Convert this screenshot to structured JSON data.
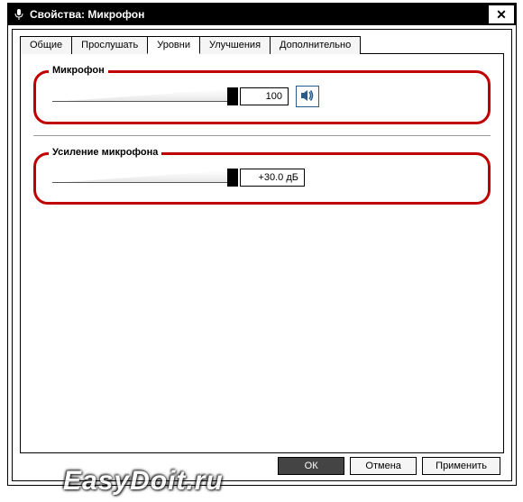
{
  "window": {
    "title": "Свойства: Микрофон",
    "close_label": "✕"
  },
  "tabs": [
    {
      "label": "Общие",
      "active": false
    },
    {
      "label": "Прослушать",
      "active": false
    },
    {
      "label": "Уровни",
      "active": true
    },
    {
      "label": "Улучшения",
      "active": false
    },
    {
      "label": "Дополнительно",
      "active": false
    }
  ],
  "groups": {
    "mic": {
      "legend": "Микрофон",
      "value": "100",
      "slider_percent": 100,
      "has_mute": true
    },
    "boost": {
      "legend": "Усиление микрофона",
      "value": "+30.0 дБ",
      "slider_percent": 100,
      "has_mute": false
    }
  },
  "buttons": {
    "ok": "ОК",
    "cancel": "Отмена",
    "apply": "Применить"
  },
  "watermark": "EasyDoit.ru"
}
